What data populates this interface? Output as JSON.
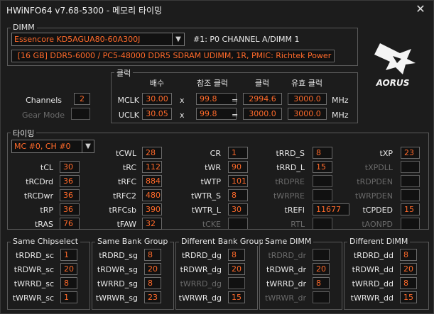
{
  "window": {
    "title": "HWiNFO64 v7.68-5300 - 메모리 타이밍",
    "close_glyph": "✕"
  },
  "dimm": {
    "group_label": "DIMM",
    "module": "Essencore KD5AGUA80-60A300J",
    "channel_info": "#1: P0 CHANNEL A/DIMM 1",
    "summary": "[16 GB] DDR5-6000 / PC5-48000 DDR5 SDRAM UDIMM, 1R, PMIC: Richtek Power"
  },
  "brand": {
    "logo_text": "AORUS"
  },
  "channels": {
    "label": "Channels",
    "value": "2",
    "gear_label": "Gear Mode",
    "gear_value": ""
  },
  "clock": {
    "group_label": "클럭",
    "headers": {
      "mult": "배수",
      "ref": "참조 클럭",
      "clock": "클럭",
      "eff": "유효 클럭"
    },
    "mclk": {
      "label": "MCLK",
      "mult": "30.00",
      "x": "x",
      "ref": "99.8",
      "eq": "=",
      "clock": "2994.6",
      "eff": "3000.0",
      "unit": "MHz"
    },
    "uclk": {
      "label": "UCLK",
      "mult": "30.05",
      "x": "x",
      "ref": "99.8",
      "eq": "=",
      "clock": "3000.0",
      "eff": "3000.0",
      "unit": "MHz"
    }
  },
  "timing": {
    "group_label": "타이밍",
    "select": "MC #0, CH #0",
    "c1": [
      {
        "label": "tCL",
        "value": "30"
      },
      {
        "label": "tRCDrd",
        "value": "36"
      },
      {
        "label": "tRCDwr",
        "value": "36"
      },
      {
        "label": "tRP",
        "value": "36"
      },
      {
        "label": "tRAS",
        "value": "76"
      }
    ],
    "c2": [
      {
        "label": "tCWL",
        "value": "28"
      },
      {
        "label": "tRC",
        "value": "112"
      },
      {
        "label": "tRFC",
        "value": "884"
      },
      {
        "label": "tRFC2",
        "value": "480"
      },
      {
        "label": "tRFCsb",
        "value": "390"
      },
      {
        "label": "tFAW",
        "value": "32"
      }
    ],
    "c3": [
      {
        "label": "CR",
        "value": "1"
      },
      {
        "label": "tWR",
        "value": "90"
      },
      {
        "label": "tWTP",
        "value": "101"
      },
      {
        "label": "tWTR_S",
        "value": "8"
      },
      {
        "label": "tWTR_L",
        "value": "30"
      },
      {
        "label": "tCKE",
        "value": ""
      }
    ],
    "c4": [
      {
        "label": "tRRD_S",
        "value": "8"
      },
      {
        "label": "tRRD_L",
        "value": "15"
      },
      {
        "label": "tRDPRE",
        "value": ""
      },
      {
        "label": "tWRPRE",
        "value": ""
      },
      {
        "label": "tREFI",
        "value": "11677"
      },
      {
        "label": "RTL",
        "value": ""
      }
    ],
    "c5": [
      {
        "label": "tXP",
        "value": "23"
      },
      {
        "label": "tXPDLL",
        "value": ""
      },
      {
        "label": "tRDPDEN",
        "value": ""
      },
      {
        "label": "tWRPDEN",
        "value": ""
      },
      {
        "label": "tCPDED",
        "value": "15"
      },
      {
        "label": "tAONPD",
        "value": ""
      }
    ]
  },
  "groups": {
    "same_cs": {
      "label": "Same Chipselect",
      "rows": [
        {
          "label": "tRDRD_sc",
          "value": "1"
        },
        {
          "label": "tRDWR_sc",
          "value": "20"
        },
        {
          "label": "tWRRD_sc",
          "value": "8"
        },
        {
          "label": "tWRWR_sc",
          "value": "1"
        }
      ]
    },
    "same_bg": {
      "label": "Same Bank Group",
      "rows": [
        {
          "label": "tRDRD_sg",
          "value": "8"
        },
        {
          "label": "tRDWR_sg",
          "value": "20"
        },
        {
          "label": "tWRRD_sg",
          "value": "8"
        },
        {
          "label": "tWRWR_sg",
          "value": "23"
        }
      ]
    },
    "diff_bg": {
      "label": "Different Bank Group",
      "rows": [
        {
          "label": "tRDRD_dg",
          "value": "8"
        },
        {
          "label": "tRDWR_dg",
          "value": "20"
        },
        {
          "label": "tWRRD_dg",
          "value": ""
        },
        {
          "label": "tWRWR_dg",
          "value": "15"
        }
      ]
    },
    "same_dimm": {
      "label": "Same DIMM",
      "rows": [
        {
          "label": "tRDRD_dr",
          "value": ""
        },
        {
          "label": "tRDWR_dr",
          "value": "20"
        },
        {
          "label": "tWRRD_dr",
          "value": "8"
        },
        {
          "label": "tWRWR_dr",
          "value": ""
        }
      ]
    },
    "diff_dimm": {
      "label": "Different DIMM",
      "rows": [
        {
          "label": "tRDRD_dd",
          "value": "8"
        },
        {
          "label": "tRDWR_dd",
          "value": "20"
        },
        {
          "label": "tWRRD_dd",
          "value": "8"
        },
        {
          "label": "tWRWR_dd",
          "value": "15"
        }
      ]
    }
  }
}
